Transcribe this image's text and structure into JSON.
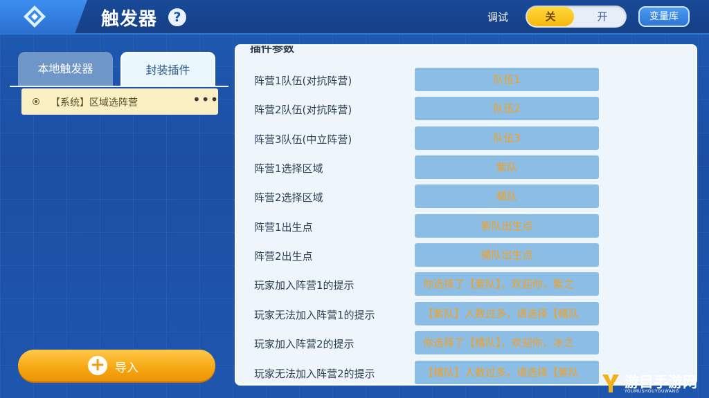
{
  "header": {
    "title": "触发器",
    "help_glyph": "?",
    "debug_label": "调试",
    "toggle_off_label": "关",
    "toggle_on_label": "开",
    "variables_button": "变量库"
  },
  "left_panel": {
    "tabs": [
      {
        "label": "本地触发器",
        "active": false
      },
      {
        "label": "封装插件",
        "active": true
      }
    ],
    "items": [
      {
        "label": "【系统】区域选阵营",
        "more": "•••"
      }
    ],
    "import_button": {
      "plus": "+",
      "label": "导入"
    }
  },
  "params_panel": {
    "header": "插件参数",
    "rows": [
      {
        "label": "阵营1队伍(对抗阵营)",
        "value": "队伍1"
      },
      {
        "label": "阵营2队伍(对抗阵营)",
        "value": "队伍2"
      },
      {
        "label": "阵营3队伍(中立阵营)",
        "value": "队伍3"
      },
      {
        "label": "阵营1选择区域",
        "value": "紫队"
      },
      {
        "label": "阵营2选择区域",
        "value": "橘队"
      },
      {
        "label": "阵营1出生点",
        "value": "紫队出生点"
      },
      {
        "label": "阵营2出生点",
        "value": "橘队出生点"
      },
      {
        "label": "玩家加入阵营1的提示",
        "value": "你选择了【紫队】，欢迎你，紫之"
      },
      {
        "label": "玩家无法加入阵营1的提示",
        "value": "【紫队】人数过多，请选择【橘队"
      },
      {
        "label": "玩家加入阵营2的提示",
        "value": "你选择了【橘队】，欢迎你，冰之"
      },
      {
        "label": "玩家无法加入阵营2的提示",
        "value": "【橘队】人数过多，请选择【紫队"
      }
    ]
  },
  "watermark": {
    "text": "游目手游网",
    "subtext": "YOUMUSHOUYOUWANG"
  },
  "colors": {
    "accent_yellow": "#f7b80e",
    "value_bg": "#8cbde4",
    "value_text": "#f5a020",
    "topbar": "#163f86"
  }
}
